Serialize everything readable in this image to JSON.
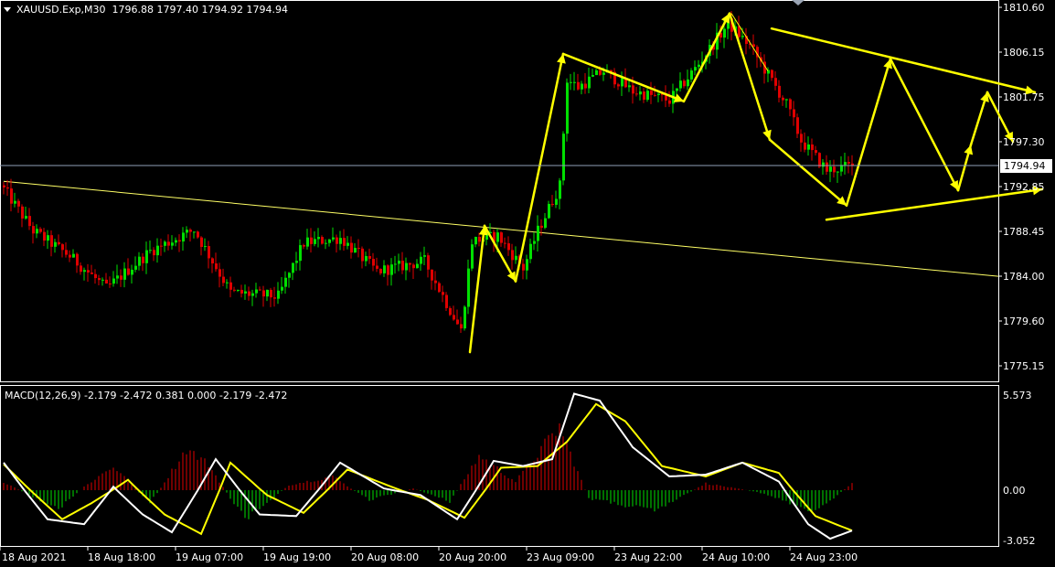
{
  "header": {
    "symbol_line": "XAUUSD.Exp,M30  1796.88 1797.40 1794.92 1794.94"
  },
  "macd": {
    "label": "MACD(12,26,9) -2.179 -2.472 0.381 0.000 -2.179 -2.472"
  },
  "price_axis": {
    "labels": [
      "1810.60",
      "1806.15",
      "1801.75",
      "1797.30",
      "1792.85",
      "1788.45",
      "1784.00",
      "1779.60",
      "1775.15"
    ],
    "current_price": "1794.94"
  },
  "macd_axis": {
    "labels": [
      "5.573",
      "0.00",
      "-3.052"
    ]
  },
  "time_axis": {
    "labels": [
      "18 Aug 2021",
      "18 Aug 18:00",
      "19 Aug 07:00",
      "19 Aug 19:00",
      "20 Aug 08:00",
      "20 Aug 20:00",
      "23 Aug 09:00",
      "23 Aug 22:00",
      "24 Aug 10:00",
      "24 Aug 23:00"
    ]
  },
  "colors": {
    "background": "#000000",
    "bull": "#00e000",
    "bear": "#e00000",
    "macd_signal": "#ffff00",
    "macd_main": "#ffffff",
    "trendline": "#ffff66",
    "annotation": "#ffff00",
    "current_price_line": "#8fa0b8"
  },
  "chart_data": {
    "type": "candlestick",
    "symbol": "XAUUSD.Exp",
    "timeframe": "M30",
    "ylim": [
      1773.5,
      1811.5
    ],
    "anchors_close": [
      [
        0,
        1792.6
      ],
      [
        8,
        1788.5
      ],
      [
        18,
        1786.0
      ],
      [
        28,
        1782.8
      ],
      [
        40,
        1786.5
      ],
      [
        52,
        1788.6
      ],
      [
        62,
        1782.4
      ],
      [
        75,
        1782.0
      ],
      [
        82,
        1787.3
      ],
      [
        92,
        1787.8
      ],
      [
        102,
        1784.5
      ],
      [
        115,
        1785.5
      ],
      [
        125,
        1778.6
      ],
      [
        128,
        1787.5
      ],
      [
        135,
        1788.0
      ],
      [
        142,
        1784.8
      ],
      [
        146,
        1788.5
      ],
      [
        152,
        1793.0
      ],
      [
        154,
        1803.5
      ],
      [
        157,
        1802.7
      ],
      [
        164,
        1804.3
      ],
      [
        172,
        1802.3
      ],
      [
        182,
        1801.4
      ],
      [
        190,
        1805.0
      ],
      [
        198,
        1809.0
      ],
      [
        204,
        1806.8
      ],
      [
        214,
        1801.0
      ],
      [
        218,
        1797.4
      ],
      [
        225,
        1794.5
      ],
      [
        232,
        1794.94
      ]
    ],
    "volatility": 1.2,
    "macd_hist_anchors": [
      [
        0,
        0.5
      ],
      [
        15,
        -1.2
      ],
      [
        22,
        0.2
      ],
      [
        30,
        1.4
      ],
      [
        40,
        -0.8
      ],
      [
        50,
        2.4
      ],
      [
        56,
        1.5
      ],
      [
        66,
        -1.8
      ],
      [
        78,
        0.3
      ],
      [
        90,
        0.8
      ],
      [
        100,
        -0.6
      ],
      [
        112,
        0.1
      ],
      [
        122,
        -0.7
      ],
      [
        130,
        2.0
      ],
      [
        140,
        0.5
      ],
      [
        152,
        3.7
      ],
      [
        160,
        -0.5
      ],
      [
        178,
        -1.3
      ],
      [
        192,
        0.4
      ],
      [
        206,
        -0.1
      ],
      [
        222,
        -1.3
      ],
      [
        232,
        0.4
      ]
    ],
    "macd_main_anchors": [
      [
        0,
        1.6
      ],
      [
        12,
        -1.8
      ],
      [
        22,
        -2.1
      ],
      [
        30,
        0.2
      ],
      [
        38,
        -1.5
      ],
      [
        46,
        -2.6
      ],
      [
        58,
        1.8
      ],
      [
        70,
        -1.5
      ],
      [
        80,
        -1.6
      ],
      [
        92,
        1.6
      ],
      [
        104,
        0.1
      ],
      [
        114,
        -0.3
      ],
      [
        124,
        -1.8
      ],
      [
        134,
        1.7
      ],
      [
        142,
        1.4
      ],
      [
        150,
        1.8
      ],
      [
        156,
        5.6
      ],
      [
        163,
        5.2
      ],
      [
        172,
        2.5
      ],
      [
        182,
        0.8
      ],
      [
        192,
        0.9
      ],
      [
        202,
        1.6
      ],
      [
        212,
        0.5
      ],
      [
        220,
        -2.1
      ],
      [
        226,
        -3.0
      ],
      [
        232,
        -2.5
      ]
    ],
    "macd_signal_anchors": [
      [
        0,
        1.5
      ],
      [
        16,
        -1.8
      ],
      [
        24,
        -0.8
      ],
      [
        34,
        0.6
      ],
      [
        44,
        -1.5
      ],
      [
        54,
        -2.7
      ],
      [
        62,
        1.6
      ],
      [
        72,
        -0.3
      ],
      [
        82,
        -1.4
      ],
      [
        94,
        1.2
      ],
      [
        106,
        0.2
      ],
      [
        116,
        -0.6
      ],
      [
        126,
        -1.7
      ],
      [
        136,
        1.3
      ],
      [
        146,
        1.4
      ],
      [
        154,
        2.8
      ],
      [
        162,
        5.0
      ],
      [
        170,
        4.0
      ],
      [
        180,
        1.4
      ],
      [
        192,
        0.8
      ],
      [
        202,
        1.6
      ],
      [
        212,
        1.0
      ],
      [
        222,
        -1.6
      ],
      [
        232,
        -2.5
      ]
    ],
    "trendline": {
      "from": [
        0,
        1793.4
      ],
      "to": [
        275,
        1784.0
      ]
    },
    "annotation_path_a": [
      [
        127.5,
        1776.5
      ],
      [
        131.5,
        1789.0
      ],
      [
        140,
        1783.5
      ],
      [
        153,
        1806.0
      ],
      [
        186,
        1801.3
      ],
      [
        198.5,
        1810.0
      ],
      [
        209.5,
        1797.5
      ],
      [
        230.5,
        1791.0
      ],
      [
        242.5,
        1805.5
      ],
      [
        261,
        1792.5
      ],
      [
        264.5,
        1797.0
      ],
      [
        269,
        1802.2
      ],
      [
        276,
        1797.3
      ]
    ],
    "annotation_line_b": [
      [
        210,
        1808.5
      ],
      [
        282,
        1802.2
      ]
    ],
    "annotation_line_c": [
      [
        225,
        1789.6
      ],
      [
        284,
        1792.6
      ]
    ],
    "upper_tail": [
      [
        199,
        1810.0
      ],
      [
        209,
        1804.3
      ]
    ]
  }
}
